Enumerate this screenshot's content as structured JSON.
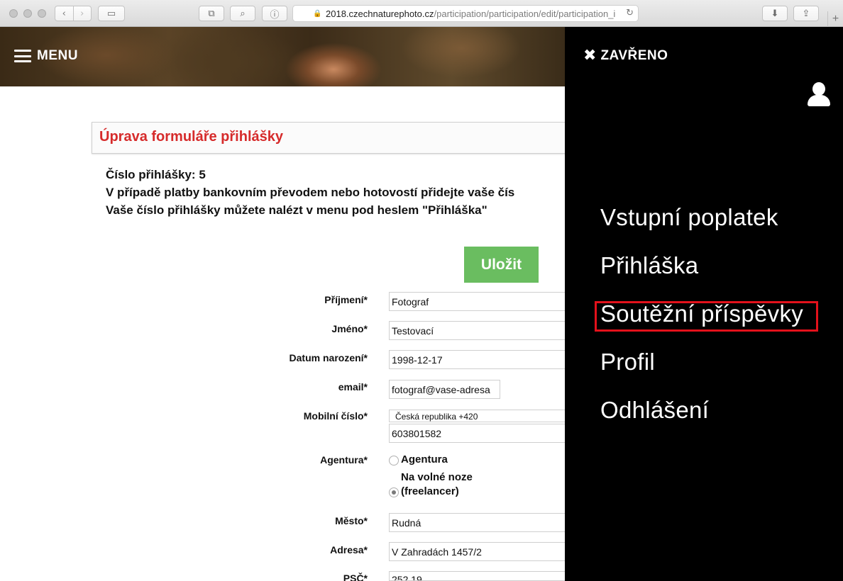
{
  "browser": {
    "url_host": "2018.czechnaturephoto.cz",
    "url_path": "/participation/participation/edit/participation_i",
    "new_tab": "+"
  },
  "page": {
    "menu_label": "MENU",
    "form_title": "Úprava formuláře přihlášky",
    "info_lines": [
      "Číslo přihlášky: 5",
      "V případě platby bankovním převodem nebo hotovostí přidejte vaše čís",
      "Vaše číslo přihlášky můžete nalézt v menu pod heslem \"Přihláška\""
    ],
    "save_label": "Uložit",
    "fields": {
      "prijmeni": {
        "label": "Příjmení*",
        "value": "Fotograf"
      },
      "jmeno": {
        "label": "Jméno*",
        "value": "Testovací"
      },
      "datum": {
        "label": "Datum narození*",
        "value": "1998-12-17"
      },
      "email": {
        "label": "email*",
        "value": "fotograf@vase-adresa"
      },
      "mobil": {
        "label": "Mobilní číslo*",
        "country": "Česká republika +420",
        "value": "603801582"
      },
      "agentura": {
        "label": "Agentura*",
        "option1": "Agentura",
        "option2_line1": "Na volné noze",
        "option2_line2": "(freelancer)",
        "selected": "freelancer"
      },
      "mesto": {
        "label": "Město*",
        "value": "Rudná"
      },
      "adresa": {
        "label": "Adresa*",
        "value": "V Zahradách 1457/2"
      },
      "psc": {
        "label": "PSČ*",
        "value": "252 19"
      }
    }
  },
  "overlay": {
    "close_label": "ZAVŘENO",
    "items": [
      "Vstupní poplatek",
      "Přihláška",
      "Soutěžní příspěvky",
      "Profil",
      "Odhlášení"
    ],
    "highlighted_item": "Soutěžní příspěvky",
    "highlight_color": "#e3111b"
  },
  "colors": {
    "title_red": "#d62b2b",
    "save_green": "#6abd60",
    "panel_bg": "#000000"
  }
}
